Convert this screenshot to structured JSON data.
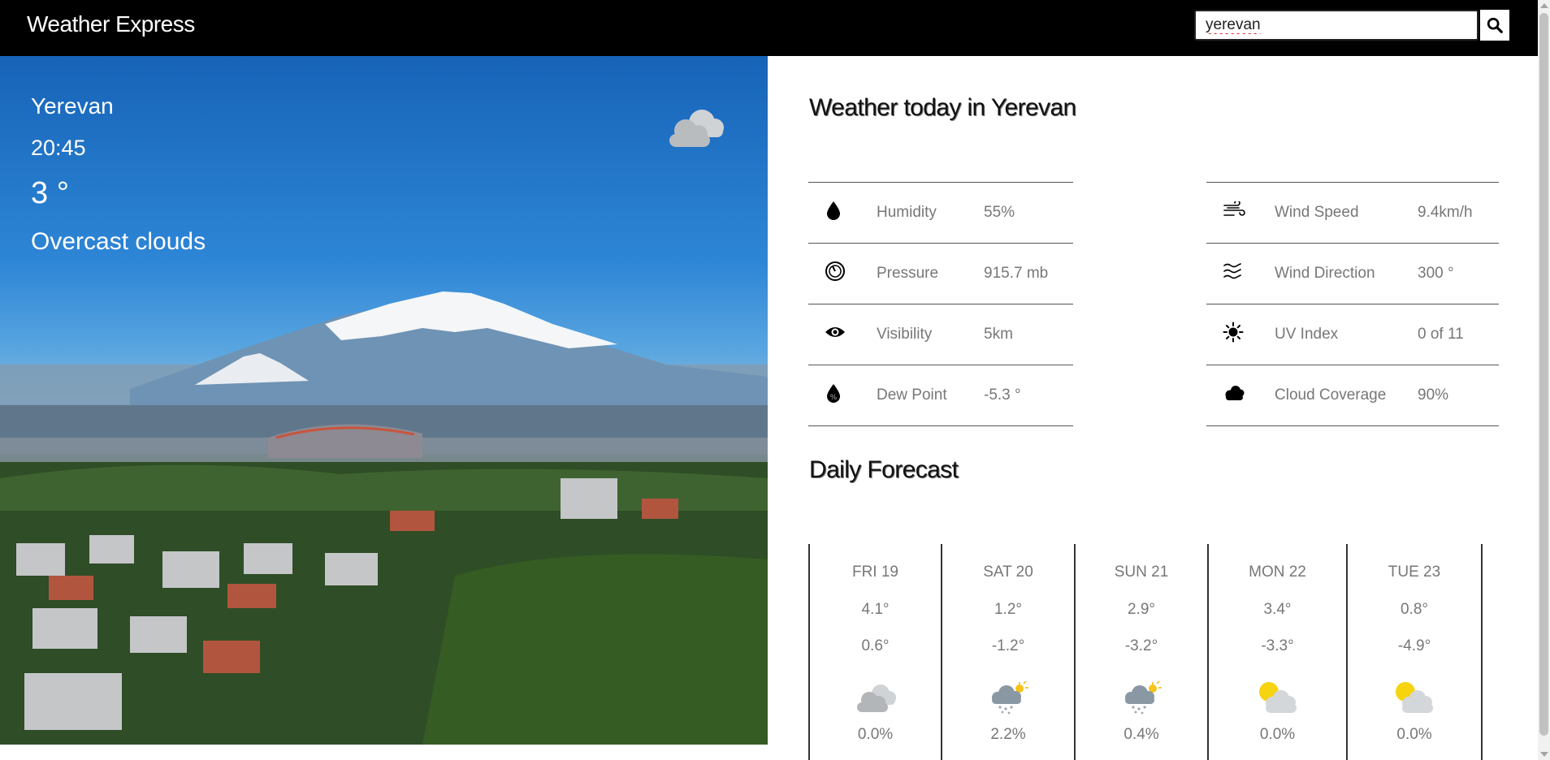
{
  "header": {
    "brand": "Weather Express",
    "search_value": "yerevan"
  },
  "current": {
    "city": "Yerevan",
    "time": "20:45",
    "temp": "3 °",
    "description": "Overcast clouds",
    "icon": "cloud-icon"
  },
  "today": {
    "title": "Weather today in Yerevan",
    "left": [
      {
        "icon": "drop-icon",
        "label": "Humidity",
        "value": "55%"
      },
      {
        "icon": "gauge-icon",
        "label": "Pressure",
        "value": "915.7 mb"
      },
      {
        "icon": "eye-icon",
        "label": "Visibility",
        "value": "5km"
      },
      {
        "icon": "dew-drop-icon",
        "label": "Dew Point",
        "value": "-5.3 °"
      }
    ],
    "right": [
      {
        "icon": "wind-icon",
        "label": "Wind Speed",
        "value": "9.4km/h"
      },
      {
        "icon": "wind-direction-icon",
        "label": "Wind Direction",
        "value": "300 °"
      },
      {
        "icon": "sun-icon",
        "label": "UV Index",
        "value": "0 of 11"
      },
      {
        "icon": "clouds-icon",
        "label": "Cloud Coverage",
        "value": "90%"
      }
    ]
  },
  "daily": {
    "title": "Daily Forecast",
    "days": [
      {
        "name": "FRI 19",
        "hi": "4.1°",
        "lo": "0.6°",
        "icon": "cloud-icon",
        "precip": "0.0%"
      },
      {
        "name": "SAT 20",
        "hi": "1.2°",
        "lo": "-1.2°",
        "icon": "snow-sun-icon",
        "precip": "2.2%"
      },
      {
        "name": "SUN 21",
        "hi": "2.9°",
        "lo": "-3.2°",
        "icon": "snow-sun-icon",
        "precip": "0.4%"
      },
      {
        "name": "MON 22",
        "hi": "3.4°",
        "lo": "-3.3°",
        "icon": "sun-cloud-icon",
        "precip": "0.0%"
      },
      {
        "name": "TUE 23",
        "hi": "0.8°",
        "lo": "-4.9°",
        "icon": "sun-cloud-icon",
        "precip": "0.0%"
      }
    ]
  }
}
